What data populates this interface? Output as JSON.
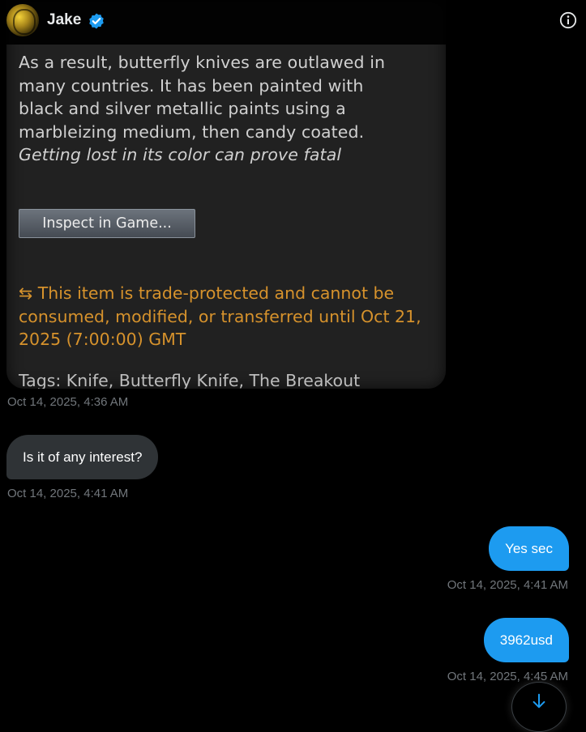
{
  "header": {
    "name": "Jake"
  },
  "card": {
    "desc_top": "...........................",
    "desc_line1": "As a result, butterfly knives are outlawed in",
    "desc_line2": "many countries. It has been painted with",
    "desc_line3": "black and silver metallic paints using a",
    "desc_line4": "marbleizing medium, then candy coated.",
    "desc_quote": "Getting lost in its color can prove fatal",
    "inspect_label": "Inspect in Game...",
    "trade_line": "⇆ This item is trade-protected and cannot be consumed, modified, or transferred until Oct 21, 2025 (7:00:00) GMT",
    "tags": "Tags: Knife, Butterfly Knife, The Breakout"
  },
  "messages": [
    {
      "timestamp": "Oct 14, 2025, 4:36 AM"
    },
    {
      "text": "Is it of any interest?",
      "timestamp": "Oct 14, 2025, 4:41 AM"
    },
    {
      "text": "Yes sec",
      "timestamp": "Oct 14, 2025, 4:41 AM"
    },
    {
      "text": "3962usd",
      "timestamp": "Oct 14, 2025, 4:45 AM"
    }
  ],
  "colors": {
    "accent": "#1d9bf0",
    "incoming_bubble": "#2f3336",
    "timestamp": "#71767b",
    "trade_text": "#d6922c"
  },
  "icons": [
    "verified-badge-icon",
    "info-icon",
    "arrow-down-icon"
  ]
}
